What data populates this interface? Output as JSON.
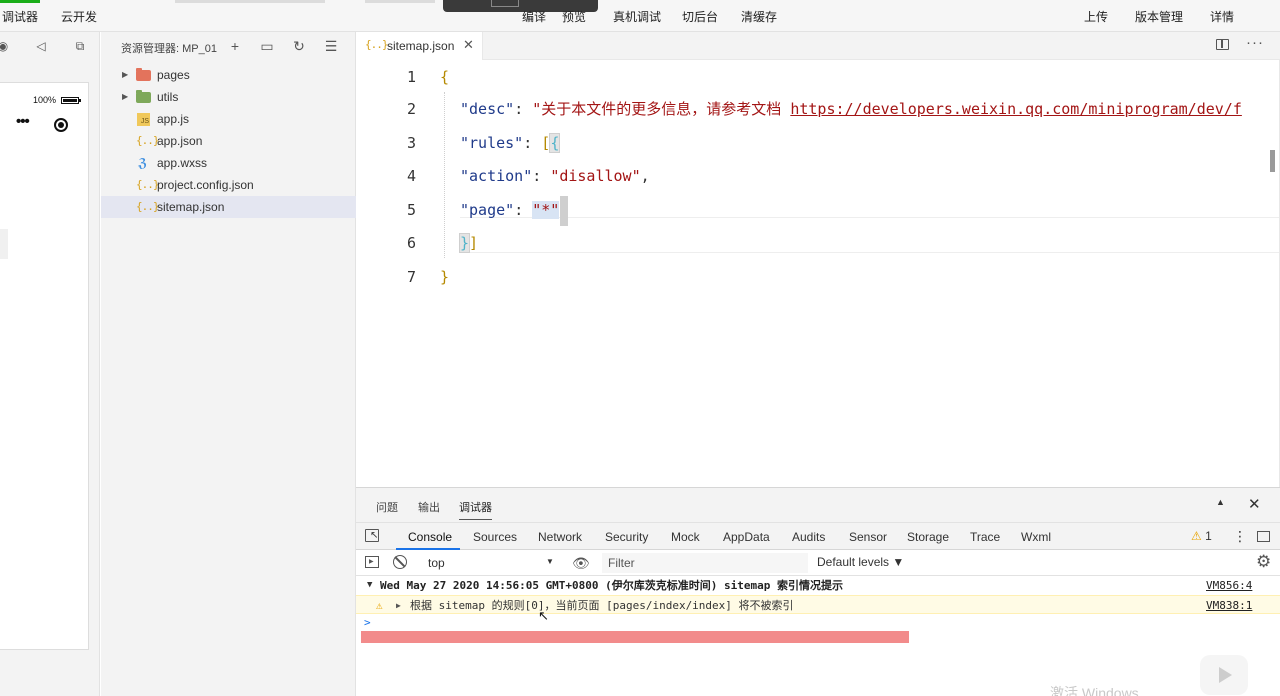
{
  "toolbar": {
    "debugger": "调试器",
    "cloud": "云开发",
    "compile": "编译",
    "preview": "预览",
    "device_debug": "真机调试",
    "background": "切后台",
    "clear_cache": "清缓存",
    "upload": "上传",
    "version_mgmt": "版本管理",
    "details": "详情"
  },
  "simulator": {
    "battery_text": "100%",
    "capsule_more_icon": "more-dots-icon",
    "capsule_close_icon": "record-circle-icon"
  },
  "explorer": {
    "title": "资源管理器: MP_01",
    "items": [
      {
        "name": "pages",
        "kind": "folder",
        "color": "#e3735c"
      },
      {
        "name": "utils",
        "kind": "folder",
        "color": "#7ea85a"
      },
      {
        "name": "app.js",
        "kind": "js"
      },
      {
        "name": "app.json",
        "kind": "json"
      },
      {
        "name": "app.wxss",
        "kind": "css"
      },
      {
        "name": "project.config.json",
        "kind": "json"
      },
      {
        "name": "sitemap.json",
        "kind": "json",
        "selected": true
      }
    ]
  },
  "editor": {
    "tab_label": "sitemap.json",
    "json_icon_text": "{..}",
    "lines": {
      "n1": "1",
      "n2": "2",
      "n3": "3",
      "n4": "4",
      "n5": "5",
      "n6": "6",
      "n7": "7",
      "open_brace": "{",
      "desc_key": "\"desc\"",
      "desc_val": "\"关于本文件的更多信息，请参考文档 ",
      "desc_url": "https://developers.weixin.qq.com/miniprogram/dev/f",
      "rules_key": "\"rules\"",
      "action_key": "\"action\"",
      "action_val": "\"disallow\"",
      "page_key": "\"page\"",
      "page_val": "\"*\"",
      "close_brace": "}"
    }
  },
  "panel": {
    "tabs": [
      "问题",
      "输出",
      "调试器"
    ],
    "active_tab": "调试器",
    "devtools_tabs": [
      "Console",
      "Sources",
      "Network",
      "Security",
      "Mock",
      "AppData",
      "Audits",
      "Sensor",
      "Storage",
      "Trace",
      "Wxml"
    ],
    "warning_count": "1",
    "context": "top",
    "filter_placeholder": "Filter",
    "levels": "Default levels ▼",
    "logs": {
      "group_msg": "Wed May 27 2020 14:56:05 GMT+0800 (伊尔库茨克标准时间) sitemap 索引情况提示",
      "group_src": "VM856:4",
      "warn_msg": "根据 sitemap 的规则[0]，当前页面 [pages/index/index] 将不被索引",
      "warn_src": "VM838:1"
    },
    "prompt": ">"
  },
  "watermark": "激活 Windows"
}
